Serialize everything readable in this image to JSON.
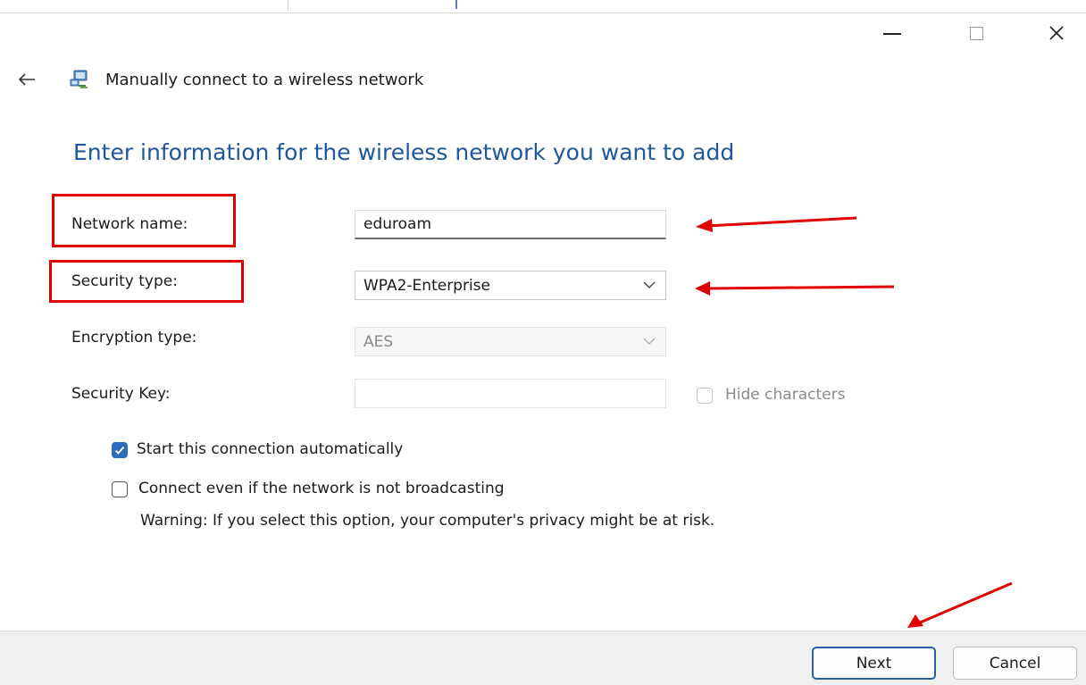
{
  "window": {
    "title": "Manually connect to a wireless network"
  },
  "heading": "Enter information for the wireless network you want to add",
  "form": {
    "network_name": {
      "label": "Network name:",
      "value": "eduroam"
    },
    "security_type": {
      "label": "Security type:",
      "value": "WPA2-Enterprise"
    },
    "encryption_type": {
      "label": "Encryption type:",
      "value": "AES"
    },
    "security_key": {
      "label": "Security Key:",
      "value": ""
    },
    "hide_characters": {
      "label": "Hide characters",
      "checked": false,
      "enabled": false
    }
  },
  "options": {
    "start_automatically": {
      "label": "Start this connection automatically",
      "checked": true
    },
    "connect_not_broadcasting": {
      "label": "Connect even if the network is not broadcasting",
      "checked": false
    },
    "warning": "Warning: If you select this option, your computer's privacy might be at risk."
  },
  "buttons": {
    "next": "Next",
    "cancel": "Cancel"
  },
  "icons": {
    "back": "back-arrow-icon",
    "app": "network-connection-icon",
    "minimize": "minimize-icon",
    "maximize": "maximize-icon",
    "close": "close-icon",
    "dropdown": "chevron-down-icon",
    "check": "checkmark-icon"
  },
  "colors": {
    "heading": "#1e56a0",
    "highlight_boxes": "#e00000",
    "checkbox_checked": "#2d6bbf",
    "footer_bg": "#f0f0f0",
    "default_button_border": "#2d5fa8"
  }
}
